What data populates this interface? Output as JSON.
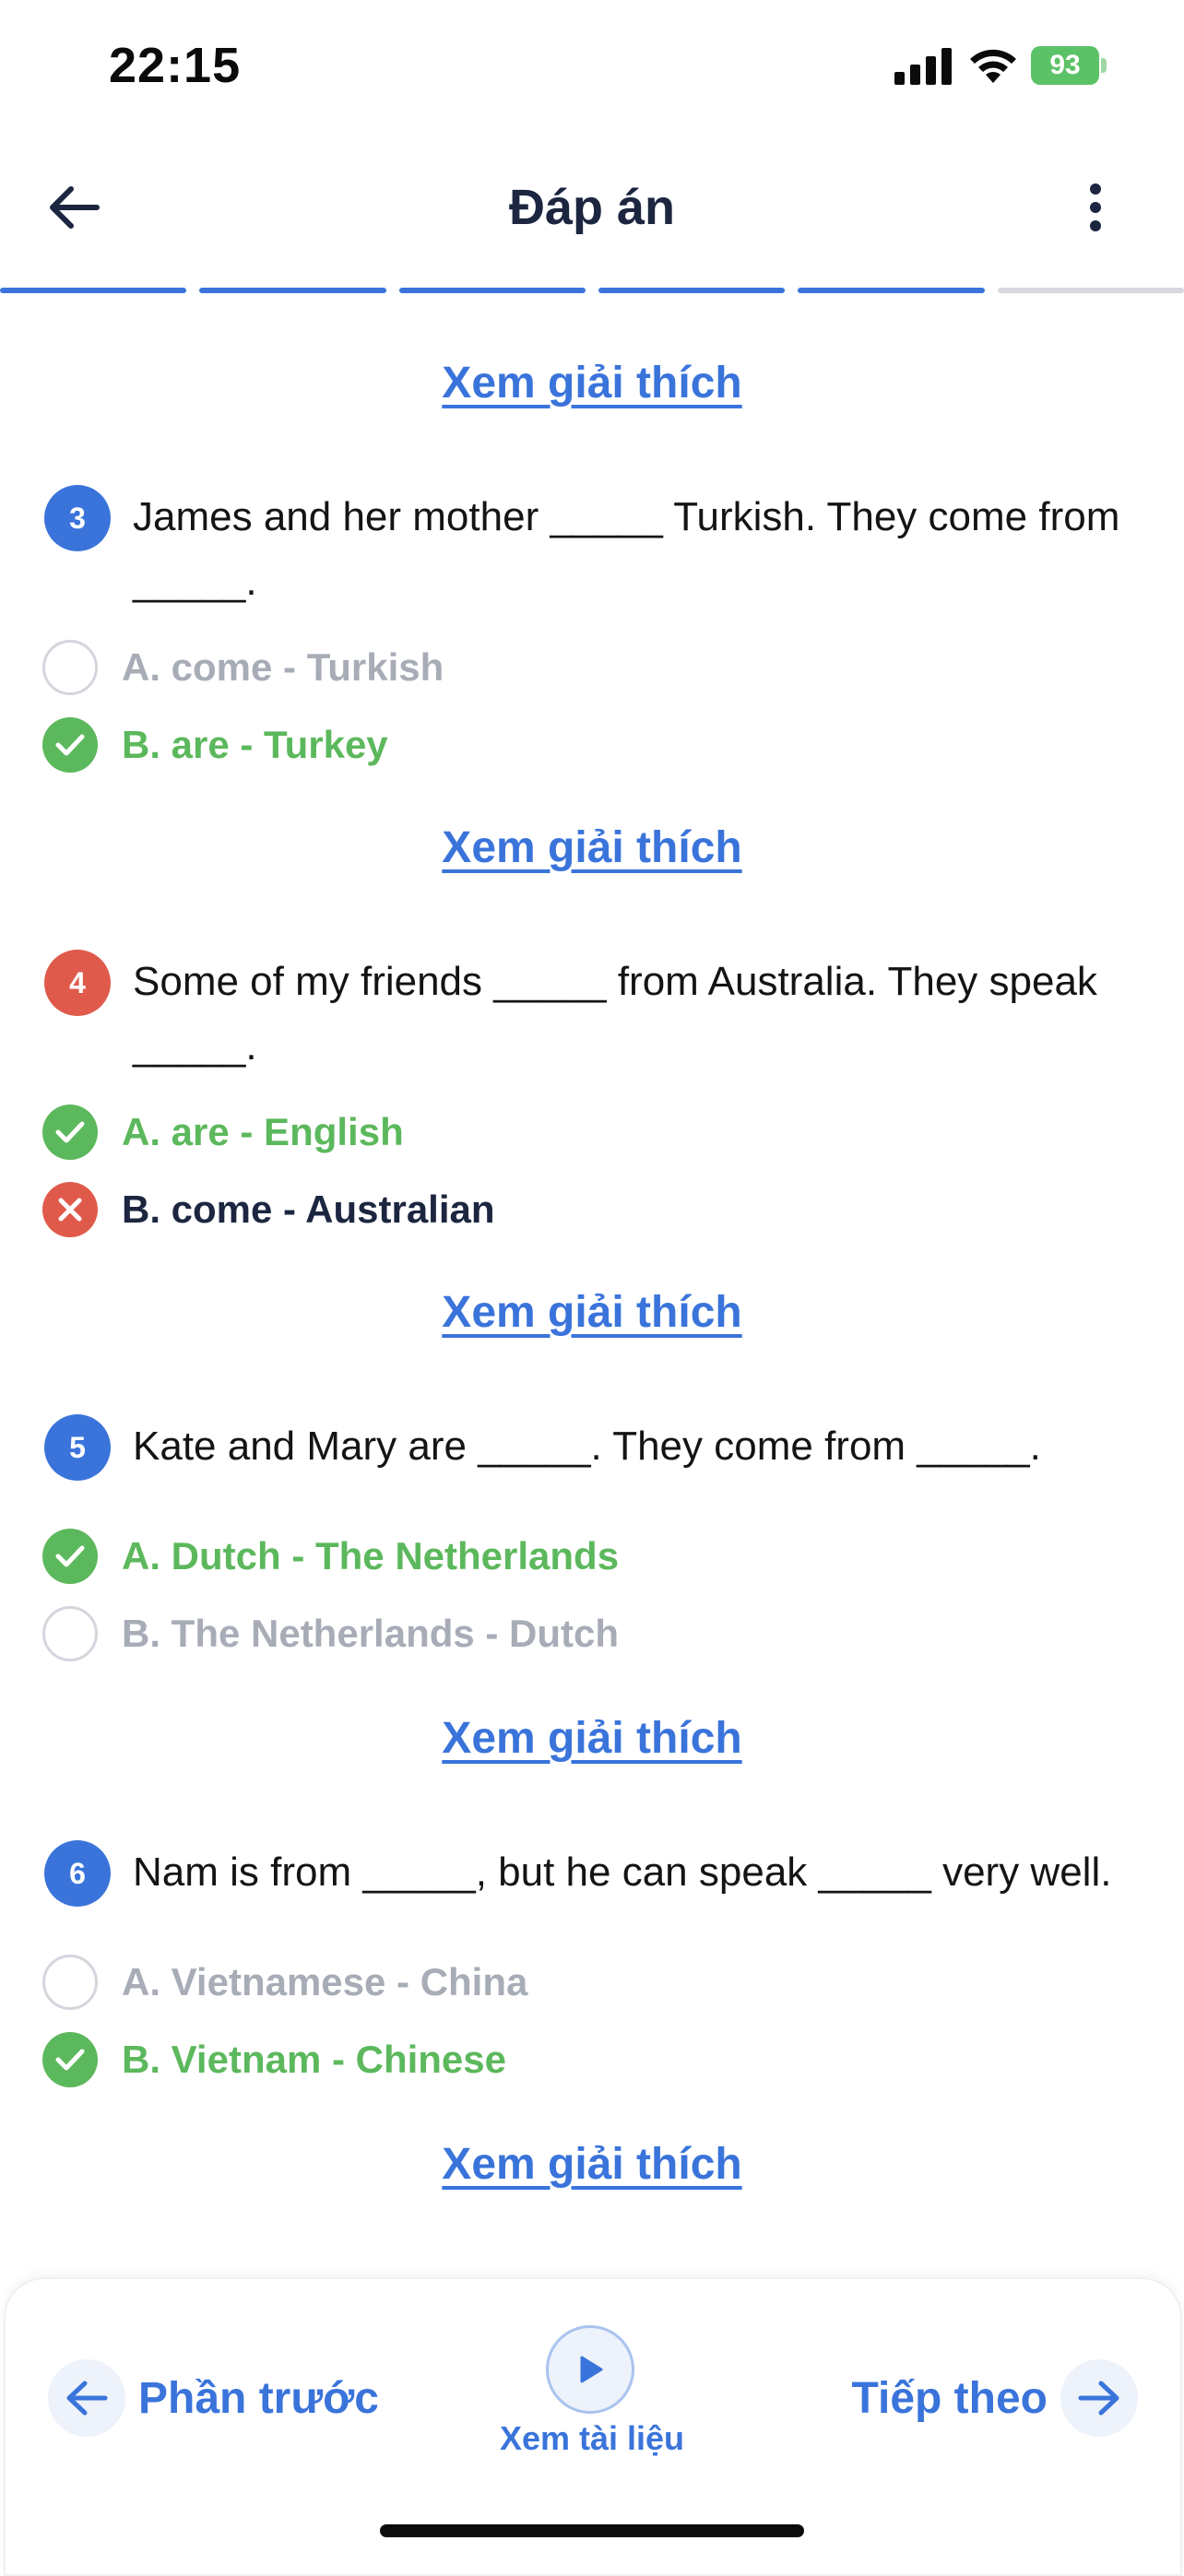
{
  "status_bar": {
    "time": "22:15",
    "battery": "93"
  },
  "header": {
    "title": "Đáp án"
  },
  "progress": {
    "total_segments": 6,
    "completed_segments": 5
  },
  "explain_label": "Xem giải thích",
  "questions": [
    {
      "number": "3",
      "text": "James and her mother _____ Turkish. They come from _____.",
      "options": [
        {
          "label": "A. come - Turkish",
          "state": "unselected"
        },
        {
          "label": "B. are - Turkey",
          "state": "correct"
        }
      ]
    },
    {
      "number": "4",
      "text": "Some of my friends _____ from Australia. They speak _____.",
      "options": [
        {
          "label": "A. are - English",
          "state": "correct"
        },
        {
          "label": "B. come - Australian",
          "state": "wrong"
        }
      ]
    },
    {
      "number": "5",
      "text": "Kate and Mary are _____. They come from _____.",
      "options": [
        {
          "label": "A. Dutch - The Netherlands",
          "state": "correct"
        },
        {
          "label": "B. The Netherlands - Dutch",
          "state": "unselected"
        }
      ]
    },
    {
      "number": "6",
      "text": "Nam is from _____, but he can speak _____ very well.",
      "options": [
        {
          "label": "A. Vietnamese - China",
          "state": "unselected"
        },
        {
          "label": "B. Vietnam - Chinese",
          "state": "correct"
        }
      ]
    }
  ],
  "bottom_bar": {
    "prev_label": "Phần trước",
    "materials_label": "Xem tài liệu",
    "next_label": "Tiếp theo"
  },
  "colors": {
    "accent_blue": "#3a74db",
    "correct_green": "#5cb85c",
    "wrong_red": "#e05a4b",
    "muted_gray": "#a7acb6",
    "title_dark": "#1c2640"
  },
  "icons": {
    "back": "arrow-left-icon",
    "more": "more-vertical-icon",
    "correct": "check-circle-icon",
    "wrong": "x-circle-icon",
    "play": "play-icon",
    "prev": "arrow-left-icon",
    "next": "arrow-right-icon"
  }
}
